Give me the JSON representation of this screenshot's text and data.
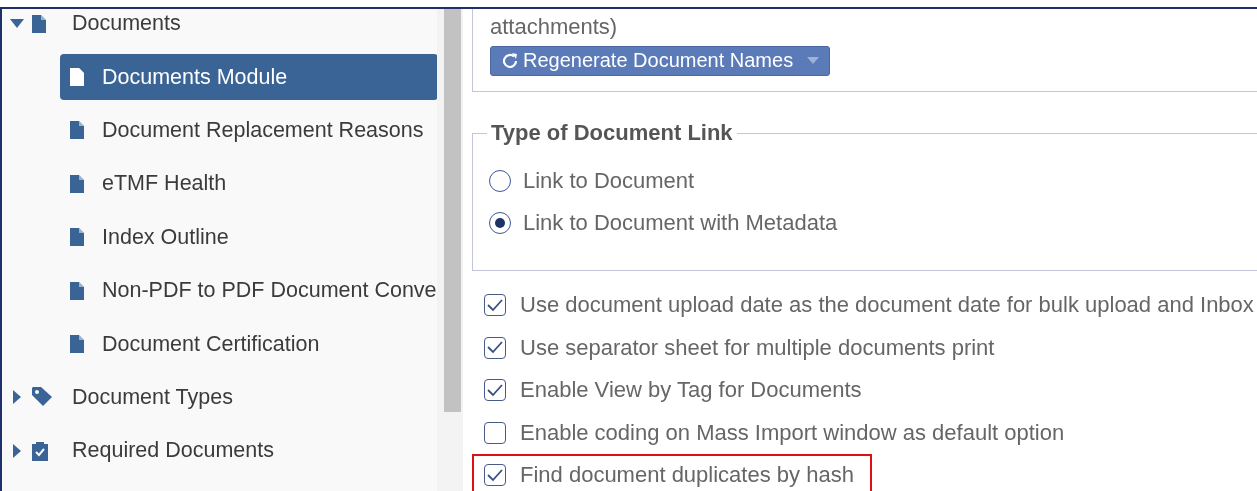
{
  "tree": [
    {
      "label": "Documents",
      "kind": "file",
      "expanded": true,
      "selected": false,
      "children": [
        {
          "label": "Documents Module",
          "kind": "file",
          "selected": true
        },
        {
          "label": "Document Replacement Reasons",
          "kind": "file",
          "selected": false
        },
        {
          "label": "eTMF Health",
          "kind": "file",
          "selected": false
        },
        {
          "label": "Index Outline",
          "kind": "file",
          "selected": false
        },
        {
          "label": "Non-PDF to PDF Document Conve",
          "kind": "file",
          "selected": false
        },
        {
          "label": "Document Certification",
          "kind": "file",
          "selected": false
        }
      ]
    },
    {
      "label": "Document Types",
      "kind": "tag",
      "expanded": false,
      "selected": false
    },
    {
      "label": "Required Documents",
      "kind": "clipboard",
      "expanded": false,
      "selected": false
    }
  ],
  "naming_section": {
    "text": "attachments)",
    "button": "Regenerate Document Names"
  },
  "link_type": {
    "legend": "Type of Document Link",
    "options": [
      {
        "label": "Link to Document",
        "selected": false
      },
      {
        "label": "Link to Document with Metadata",
        "selected": true
      }
    ]
  },
  "options": [
    {
      "label": "Use document upload date as the document date for bulk upload and Inbox",
      "checked": true,
      "highlighted": false
    },
    {
      "label": "Use separator sheet for multiple documents print",
      "checked": true,
      "highlighted": false
    },
    {
      "label": "Enable View by Tag for Documents",
      "checked": true,
      "highlighted": false
    },
    {
      "label": "Enable coding on Mass Import window as default option",
      "checked": false,
      "highlighted": false
    },
    {
      "label": "Find document duplicates by hash",
      "checked": true,
      "highlighted": true
    }
  ]
}
